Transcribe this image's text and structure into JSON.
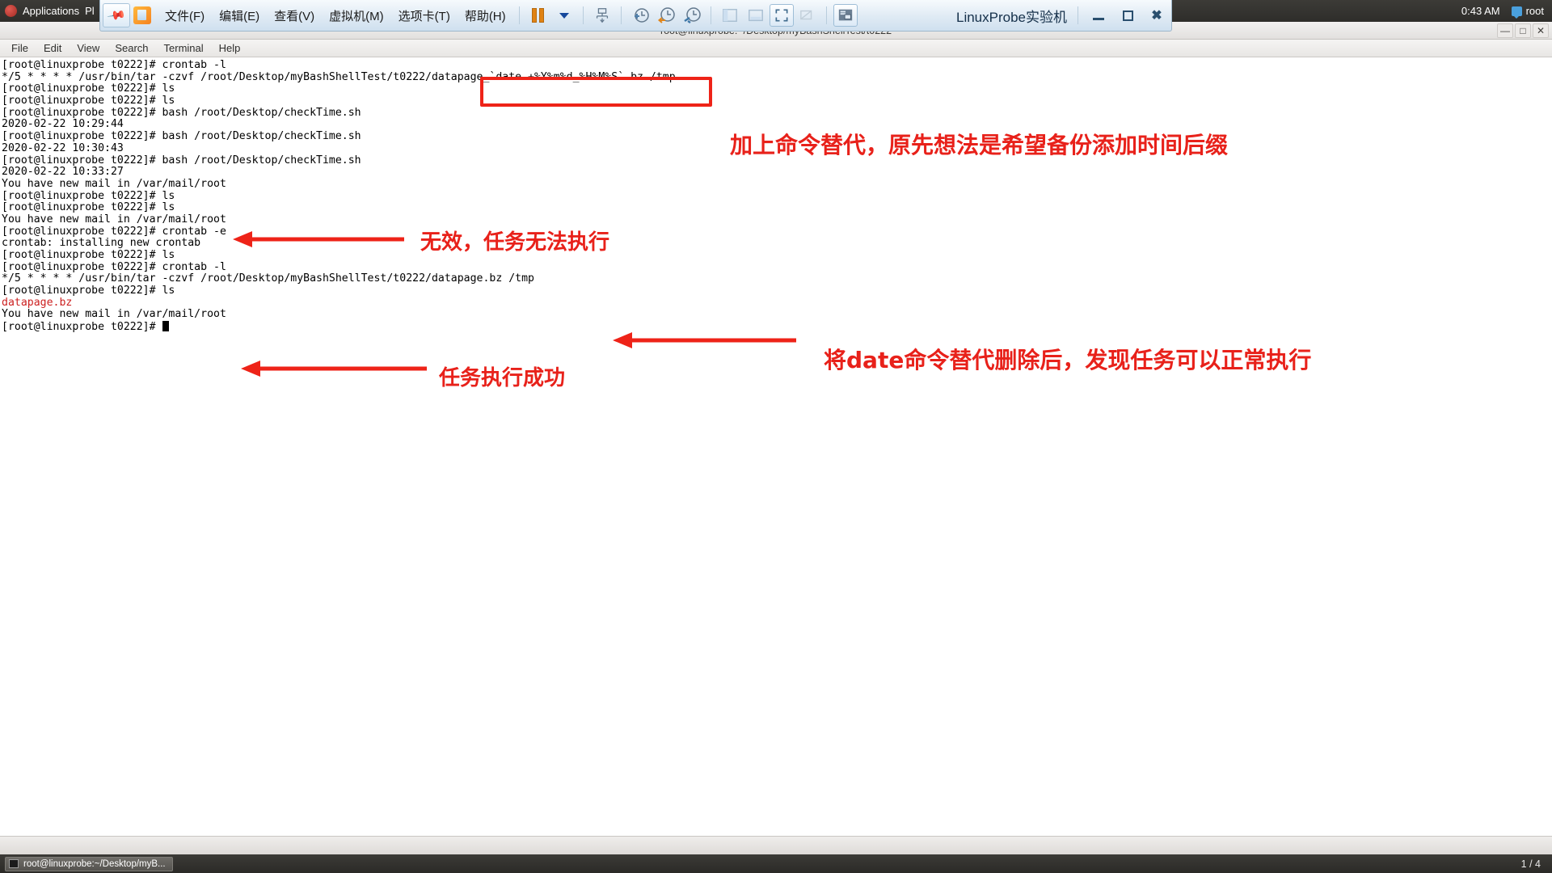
{
  "gnome_panel": {
    "applications_label": "Applications",
    "places_label": "Pl",
    "clock": "0:43 AM",
    "user": "root",
    "redhat_icon": "redhat-logo-icon",
    "user_icon": "user-status-icon"
  },
  "vmware": {
    "pin_icon": "pin-icon",
    "app_icon": "vm-app-icon",
    "menus": [
      {
        "label": "文件(F)",
        "name": "menu-file"
      },
      {
        "label": "编辑(E)",
        "name": "menu-edit"
      },
      {
        "label": "查看(V)",
        "name": "menu-view"
      },
      {
        "label": "虚拟机(M)",
        "name": "menu-vm"
      },
      {
        "label": "选项卡(T)",
        "name": "menu-tabs"
      },
      {
        "label": "帮助(H)",
        "name": "menu-help"
      }
    ],
    "toolbar": [
      {
        "name": "pause-button",
        "icon": "pause-icon"
      },
      {
        "name": "power-dropdown-button",
        "icon": "chevron-down-icon"
      },
      {
        "name": "snapshot-button",
        "icon": "snapshot-icon"
      },
      {
        "name": "take-snapshot-button",
        "icon": "clock-plus-icon"
      },
      {
        "name": "revert-snapshot-button",
        "icon": "clock-back-icon"
      },
      {
        "name": "snapshot-manager-button",
        "icon": "clock-wrench-icon"
      },
      {
        "name": "show-sidebar-button",
        "icon": "sidebar-panel-icon"
      },
      {
        "name": "show-thumbnail-button",
        "icon": "thumbnail-bar-icon"
      },
      {
        "name": "fullscreen-button",
        "icon": "fullscreen-icon"
      },
      {
        "name": "unity-mode-button",
        "icon": "unity-mode-icon"
      },
      {
        "name": "console-view-button",
        "icon": "console-view-icon"
      }
    ],
    "title": "LinuxProbe实验机",
    "window_buttons": [
      {
        "name": "minimize-button",
        "icon": "minimize-icon"
      },
      {
        "name": "restore-button",
        "icon": "restore-icon"
      },
      {
        "name": "close-button",
        "icon": "close-icon"
      }
    ]
  },
  "terminal": {
    "window_title": "root@linuxprobe:~/Desktop/myBashShellTest/t0222",
    "window_buttons": [
      {
        "name": "terminal-minimize-button",
        "label": "—"
      },
      {
        "name": "terminal-maximize-button",
        "label": "□"
      },
      {
        "name": "terminal-close-button",
        "label": "✕"
      }
    ],
    "menus": [
      {
        "label": "File",
        "name": "terminal-menu-file"
      },
      {
        "label": "Edit",
        "name": "terminal-menu-edit"
      },
      {
        "label": "View",
        "name": "terminal-menu-view"
      },
      {
        "label": "Search",
        "name": "terminal-menu-search"
      },
      {
        "label": "Terminal",
        "name": "terminal-menu-terminal"
      },
      {
        "label": "Help",
        "name": "terminal-menu-help"
      }
    ],
    "lines": [
      {
        "text": "[root@linuxprobe t0222]# crontab -l",
        "color": "default"
      },
      {
        "text": "*/5 * * * * /usr/bin/tar -czvf /root/Desktop/myBashShellTest/t0222/datapage_`date +%Y%m%d_%H%M%S`.bz /tmp",
        "color": "default"
      },
      {
        "text": "[root@linuxprobe t0222]# ls",
        "color": "default"
      },
      {
        "text": "[root@linuxprobe t0222]# ls",
        "color": "default"
      },
      {
        "text": "[root@linuxprobe t0222]# bash /root/Desktop/checkTime.sh",
        "color": "default"
      },
      {
        "text": "2020-02-22 10:29:44",
        "color": "default"
      },
      {
        "text": "[root@linuxprobe t0222]# bash /root/Desktop/checkTime.sh",
        "color": "default"
      },
      {
        "text": "2020-02-22 10:30:43",
        "color": "default"
      },
      {
        "text": "[root@linuxprobe t0222]# bash /root/Desktop/checkTime.sh",
        "color": "default"
      },
      {
        "text": "2020-02-22 10:33:27",
        "color": "default"
      },
      {
        "text": "You have new mail in /var/mail/root",
        "color": "default"
      },
      {
        "text": "[root@linuxprobe t0222]# ls",
        "color": "default"
      },
      {
        "text": "[root@linuxprobe t0222]# ls",
        "color": "default"
      },
      {
        "text": "You have new mail in /var/mail/root",
        "color": "default"
      },
      {
        "text": "[root@linuxprobe t0222]# crontab -e",
        "color": "default"
      },
      {
        "text": "crontab: installing new crontab",
        "color": "default"
      },
      {
        "text": "[root@linuxprobe t0222]# ls",
        "color": "default"
      },
      {
        "text": "[root@linuxprobe t0222]# crontab -l",
        "color": "default"
      },
      {
        "text": "*/5 * * * * /usr/bin/tar -czvf /root/Desktop/myBashShellTest/t0222/datapage.bz /tmp",
        "color": "default"
      },
      {
        "text": "[root@linuxprobe t0222]# ls",
        "color": "default"
      },
      {
        "text": "datapage.bz",
        "color": "red"
      },
      {
        "text": "You have new mail in /var/mail/root",
        "color": "default"
      },
      {
        "text": "[root@linuxprobe t0222]# ",
        "color": "default"
      }
    ],
    "cursor": "block-cursor"
  },
  "taskbar": {
    "button_label": "root@linuxprobe:~/Desktop/myB...",
    "button_icon": "terminal-icon",
    "workspace_indicator": "1 / 4"
  },
  "annotations": {
    "highlight_box_label": "command-substitution-highlight",
    "notes": [
      {
        "text": "加上命令替代，原先想法是希望备份添加时间后缀",
        "name": "annotation-note-1"
      },
      {
        "text": "无效，任务无法执行",
        "name": "annotation-note-2"
      },
      {
        "text": "将date命令替代删除后，发现任务可以正常执行",
        "name": "annotation-note-3"
      },
      {
        "text": "任务执行成功",
        "name": "annotation-note-4"
      }
    ],
    "arrows": [
      {
        "name": "annotation-arrow-1"
      },
      {
        "name": "annotation-arrow-2"
      },
      {
        "name": "annotation-arrow-3"
      }
    ],
    "color": "#ee2318"
  }
}
